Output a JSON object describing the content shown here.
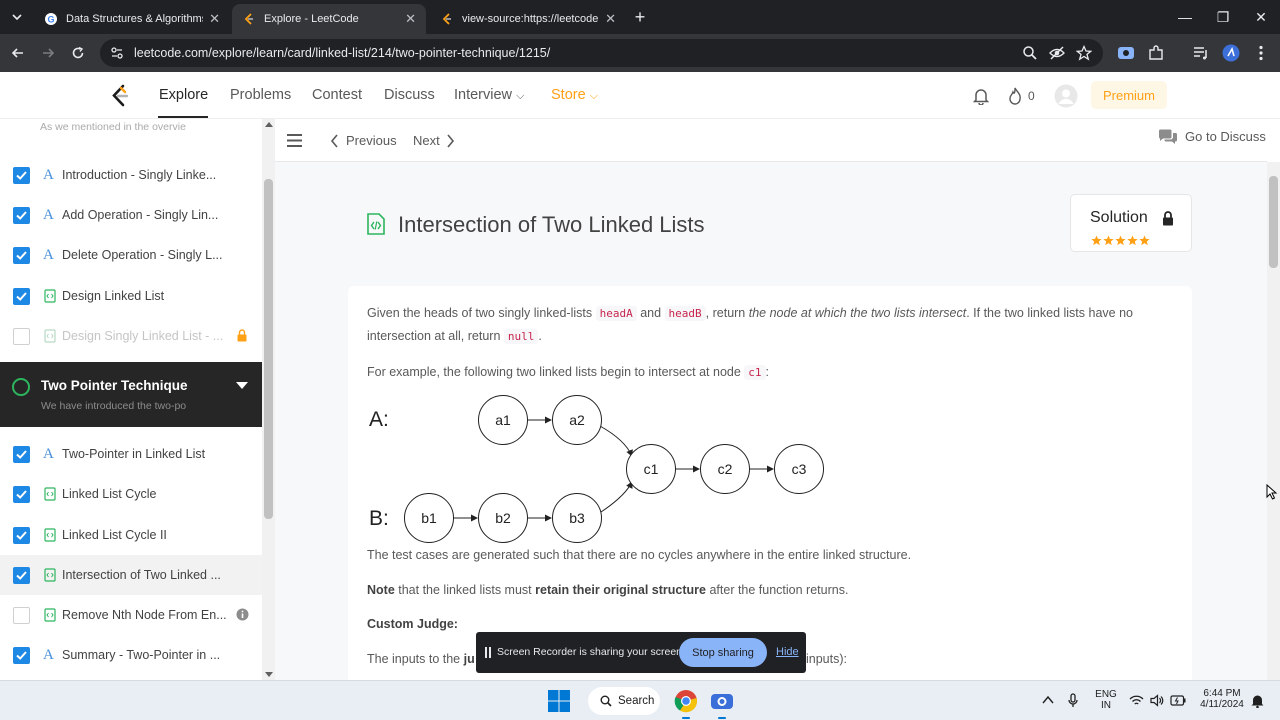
{
  "browser": {
    "tabs": [
      {
        "title": "Data Structures & Algorithms",
        "active": false
      },
      {
        "title": "Explore - LeetCode",
        "active": true
      },
      {
        "title": "view-source:https://leetcode.co",
        "active": false
      }
    ],
    "url": "leetcode.com/explore/learn/card/linked-list/214/two-pointer-technique/1215/"
  },
  "header": {
    "nav": [
      "Explore",
      "Problems",
      "Contest",
      "Discuss",
      "Interview",
      "Store"
    ],
    "fire_count": "0",
    "premium_label": "Premium"
  },
  "sidebar": {
    "faded_top_text": "As we mentioned in the overvie",
    "items_top": [
      {
        "label": "Introduction - Singly Linke...",
        "checked": true,
        "icon": "article-icon"
      },
      {
        "label": "Add Operation - Singly Lin...",
        "checked": true,
        "icon": "article-icon"
      },
      {
        "label": "Delete Operation - Singly L...",
        "checked": true,
        "icon": "article-icon"
      },
      {
        "label": "Design Linked List",
        "checked": true,
        "icon": "code-file-icon"
      },
      {
        "label": "Design Singly Linked List - ...",
        "checked": false,
        "icon": "code-file-icon"
      }
    ],
    "section": {
      "title": "Two Pointer Technique",
      "subtitle": "We have introduced the two-po"
    },
    "items_bottom": [
      {
        "label": "Two-Pointer in Linked List",
        "checked": true,
        "icon": "article-icon"
      },
      {
        "label": "Linked List Cycle",
        "checked": true,
        "icon": "code-file-icon"
      },
      {
        "label": "Linked List Cycle II",
        "checked": true,
        "icon": "code-file-icon"
      },
      {
        "label": "Intersection of Two Linked ...",
        "checked": true,
        "icon": "code-file-icon"
      },
      {
        "label": "Remove Nth Node From En...",
        "checked": false,
        "icon": "code-file-icon"
      },
      {
        "label": "Summary - Two-Pointer in ...",
        "checked": true,
        "icon": "article-icon"
      }
    ]
  },
  "toolbar": {
    "previous": "Previous",
    "next": "Next",
    "discuss": "Go to Discuss"
  },
  "problem": {
    "title": "Intersection of Two Linked Lists",
    "solution_label": "Solution",
    "rating_stars": 5,
    "p1_a": "Given the heads of two singly linked-lists ",
    "p1_code1": "headA",
    "p1_b": " and ",
    "p1_code2": "headB",
    "p1_c": ", return ",
    "p1_italic": "the node at which the two lists intersect",
    "p1_d": ". If the two linked lists have no intersection at all, return ",
    "p1_code3": "null",
    "p1_e": ".",
    "p2_a": "For example, the following two linked lists begin to intersect at node ",
    "p2_code": "c1",
    "p2_b": ":",
    "diagram": {
      "label_a": "A:",
      "label_b": "B:",
      "list_a": [
        "a1",
        "a2"
      ],
      "list_b": [
        "b1",
        "b2",
        "b3"
      ],
      "shared": [
        "c1",
        "c2",
        "c3"
      ]
    },
    "p3": "The test cases are generated such that there are no cycles anywhere in the entire linked structure.",
    "p4_bold1": "Note",
    "p4_a": " that the linked lists must ",
    "p4_bold2": "retain their original structure",
    "p4_b": " after the function returns.",
    "p5_bold": "Custom Judge:",
    "p6_a": "The inputs to the ",
    "p6_bold": "ju",
    "p6_b": "inputs):"
  },
  "share_bar": {
    "text": "Screen Recorder is sharing your screen.",
    "stop": "Stop sharing",
    "hide": "Hide"
  },
  "taskbar": {
    "search": "Search",
    "lang1": "ENG",
    "lang2": "IN",
    "time": "6:44 PM",
    "date": "4/11/2024"
  },
  "colors": {
    "accent_orange": "#ffa116",
    "check_blue": "#1e88e5",
    "progress_green": "#2db55d"
  }
}
